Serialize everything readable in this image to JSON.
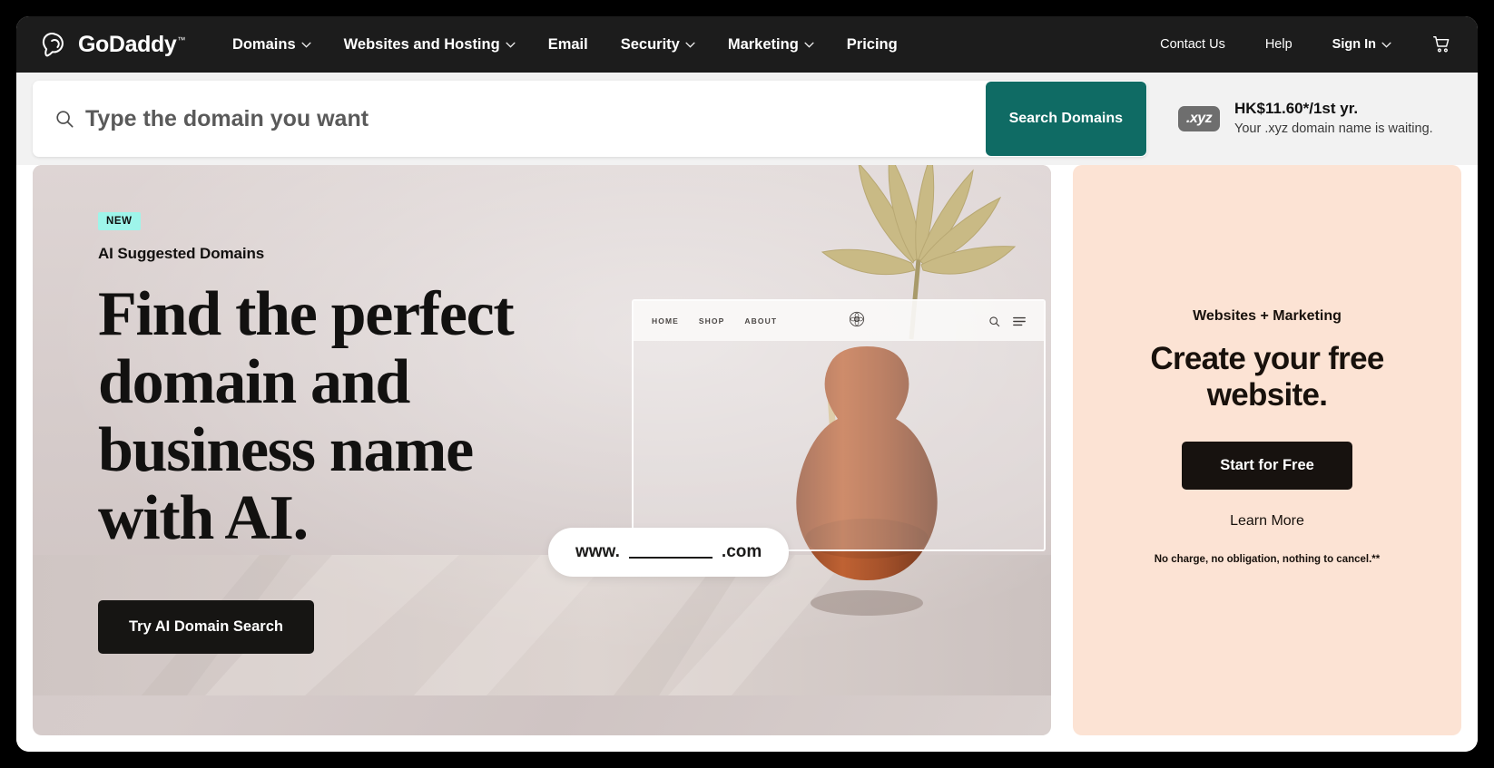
{
  "nav": {
    "logo_text": "GoDaddy",
    "logo_tm": "™",
    "items": [
      {
        "label": "Domains",
        "has_chevron": true
      },
      {
        "label": "Websites and Hosting",
        "has_chevron": true
      },
      {
        "label": "Email",
        "has_chevron": false
      },
      {
        "label": "Security",
        "has_chevron": true
      },
      {
        "label": "Marketing",
        "has_chevron": true
      },
      {
        "label": "Pricing",
        "has_chevron": false
      }
    ],
    "right_items": [
      {
        "label": "Contact Us",
        "has_chevron": false
      },
      {
        "label": "Help",
        "has_chevron": false
      },
      {
        "label": "Sign In",
        "has_chevron": true
      }
    ],
    "cart_icon": "shopping-cart-icon"
  },
  "search": {
    "placeholder": "Type the domain you want",
    "value": "",
    "button_label": "Search Domains",
    "button_color": "#0f6b64",
    "icon": "search-icon"
  },
  "promo": {
    "badge_text": ".xyz",
    "title": "HK$11.60*/1st yr.",
    "subtitle": "Your .xyz domain name is waiting."
  },
  "hero": {
    "badge": "NEW",
    "badge_color": "#9ef5ea",
    "kicker": "AI Suggested Domains",
    "heading": "Find the perfect domain and business name with AI.",
    "cta_label": "Try AI Domain Search",
    "artwork": {
      "browser_nav": [
        "HOME",
        "SHOP",
        "ABOUT"
      ],
      "url_prefix": "www.",
      "url_suffix": ".com",
      "logo_icon": "flower-medallion-icon",
      "search_icon": "search-icon",
      "menu_icon": "hamburger-icon"
    }
  },
  "side_card": {
    "kicker": "Websites + Marketing",
    "heading": "Create your free website.",
    "cta_label": "Start for Free",
    "link_label": "Learn More",
    "note": "No charge, no obligation, nothing to cancel.**",
    "bg_color": "#fce3d4"
  }
}
